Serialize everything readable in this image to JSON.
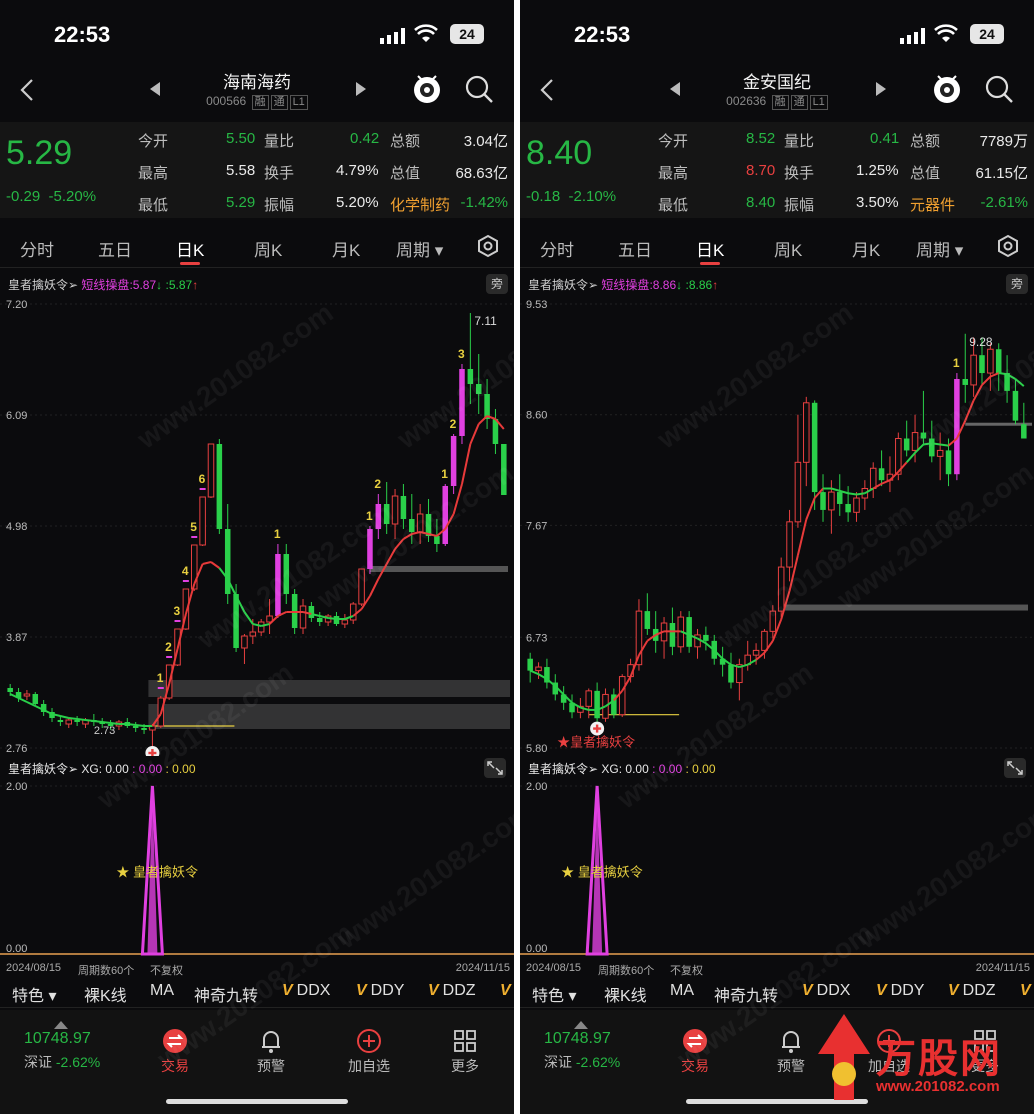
{
  "status_bar": {
    "time": "22:53",
    "battery": "24"
  },
  "bottom_tabs": {
    "index_value": "10748.97",
    "index_name": "深证",
    "index_change": "-2.62%",
    "trade": "交易",
    "alert": "预警",
    "add_watch": "加自选",
    "more": "更多"
  },
  "period_tabs": [
    "分时",
    "五日",
    "日K",
    "周K",
    "月K",
    "周期"
  ],
  "tools": {
    "special": "特色",
    "items": [
      "裸K线",
      "MA",
      "神奇九转"
    ],
    "v_items": [
      "DDX",
      "DDY",
      "DDZ"
    ]
  },
  "labels": {
    "open": "今开",
    "vol_ratio": "量比",
    "amount": "总额",
    "high": "最高",
    "turnover": "换手",
    "mktcap": "总值",
    "low": "最低",
    "amplitude": "振幅",
    "indicator_name": "皇者擒妖令",
    "pang": "旁",
    "signal_label": "★皇者擒妖令",
    "sub_signal_label": "★ 皇者擒妖令",
    "axis_start": "2024/08/15",
    "axis_period": "周期数60个",
    "axis_adj": "不复权",
    "axis_end": "2024/11/15"
  },
  "stocks": [
    {
      "name": "海南海药",
      "code": "000566",
      "tags": [
        "融",
        "通",
        "L1"
      ],
      "price": "5.29",
      "change": "-0.29",
      "change_pct": "-5.20%",
      "open": "5.50",
      "open_color": "g",
      "vol_ratio": "0.42",
      "amount": "3.04亿",
      "high": "5.58",
      "high_color": "w",
      "turnover": "4.79%",
      "mktcap": "68.63亿",
      "low": "5.29",
      "low_color": "g",
      "amplitude": "5.20%",
      "sector": "化学制药",
      "sector_pct": "-1.42%",
      "indicator": {
        "label": "短线操盘",
        "v1": "5.87",
        "v2": ":5.87"
      },
      "y_ticks": [
        "7.20",
        "6.09",
        "4.98",
        "3.87",
        "2.76"
      ],
      "ymin": 2.76,
      "ymax": 7.2,
      "peak_label": "7.11",
      "low_label": "2.73",
      "xg": {
        "label": "XG: 0.00",
        "v2": ": 0.00",
        "v3": ": 0.00"
      },
      "sub_y_ticks": [
        "2.00",
        "0.00"
      ],
      "signal_index": 17,
      "chart_data": {
        "type": "candlestick",
        "x": "trading days 2024/08/15 – 2024/11/15 (60)",
        "candles": [
          [
            3.36,
            3.4,
            3.28,
            3.32
          ],
          [
            3.32,
            3.36,
            3.22,
            3.26
          ],
          [
            3.28,
            3.34,
            3.24,
            3.3
          ],
          [
            3.3,
            3.32,
            3.18,
            3.2
          ],
          [
            3.2,
            3.24,
            3.08,
            3.12
          ],
          [
            3.12,
            3.16,
            3.02,
            3.06
          ],
          [
            3.04,
            3.08,
            2.98,
            3.02
          ],
          [
            3.0,
            3.06,
            2.96,
            3.04
          ],
          [
            3.04,
            3.08,
            2.98,
            3.02
          ],
          [
            3.0,
            3.06,
            2.96,
            3.04
          ],
          [
            3.04,
            3.1,
            2.98,
            3.02
          ],
          [
            3.02,
            3.06,
            2.96,
            3.0
          ],
          [
            3.0,
            3.04,
            2.94,
            2.98
          ],
          [
            2.98,
            3.04,
            2.94,
            3.02
          ],
          [
            3.02,
            3.06,
            2.96,
            2.98
          ],
          [
            2.98,
            3.02,
            2.92,
            2.96
          ],
          [
            2.96,
            3.0,
            2.9,
            2.94
          ],
          [
            2.94,
            3.0,
            2.73,
            2.98
          ],
          [
            2.98,
            3.28,
            2.96,
            3.26
          ],
          [
            3.26,
            3.59,
            3.24,
            3.59
          ],
          [
            3.59,
            3.95,
            3.58,
            3.95
          ],
          [
            3.95,
            4.35,
            3.94,
            4.35
          ],
          [
            4.35,
            4.79,
            4.33,
            4.79
          ],
          [
            4.79,
            5.27,
            4.78,
            5.27
          ],
          [
            5.27,
            5.8,
            5.26,
            5.8
          ],
          [
            5.8,
            5.85,
            4.9,
            4.95
          ],
          [
            4.95,
            5.2,
            4.2,
            4.3
          ],
          [
            4.3,
            4.4,
            3.72,
            3.76
          ],
          [
            3.76,
            3.9,
            3.6,
            3.88
          ],
          [
            3.88,
            4.05,
            3.8,
            3.92
          ],
          [
            3.92,
            4.05,
            3.88,
            4.02
          ],
          [
            4.02,
            4.25,
            3.9,
            4.08
          ],
          [
            4.08,
            4.8,
            4.06,
            4.7
          ],
          [
            4.7,
            4.8,
            4.2,
            4.3
          ],
          [
            4.3,
            4.35,
            3.9,
            3.96
          ],
          [
            3.96,
            4.25,
            3.9,
            4.18
          ],
          [
            4.18,
            4.22,
            4.02,
            4.06
          ],
          [
            4.06,
            4.12,
            3.98,
            4.02
          ],
          [
            4.02,
            4.1,
            3.98,
            4.08
          ],
          [
            4.08,
            4.12,
            3.98,
            4.0
          ],
          [
            4.0,
            4.1,
            3.96,
            4.04
          ],
          [
            4.04,
            4.22,
            4.0,
            4.2
          ],
          [
            4.2,
            4.55,
            4.18,
            4.55
          ],
          [
            4.55,
            4.98,
            4.5,
            4.95
          ],
          [
            4.95,
            5.3,
            4.85,
            5.2
          ],
          [
            5.2,
            5.42,
            4.9,
            5.0
          ],
          [
            5.0,
            5.35,
            4.85,
            5.28
          ],
          [
            5.28,
            5.4,
            4.95,
            5.05
          ],
          [
            5.05,
            5.3,
            4.8,
            4.92
          ],
          [
            4.92,
            5.2,
            4.8,
            5.1
          ],
          [
            5.1,
            5.25,
            4.82,
            4.88
          ],
          [
            4.88,
            5.05,
            4.72,
            4.8
          ],
          [
            4.8,
            5.4,
            4.78,
            5.38
          ],
          [
            5.38,
            5.9,
            5.3,
            5.88
          ],
          [
            5.88,
            6.6,
            5.8,
            6.55
          ],
          [
            6.55,
            7.11,
            6.2,
            6.4
          ],
          [
            6.4,
            6.7,
            6.1,
            6.3
          ],
          [
            6.3,
            6.45,
            5.95,
            6.05
          ],
          [
            6.05,
            6.15,
            5.7,
            5.8
          ],
          [
            5.8,
            5.58,
            5.29,
            5.29
          ]
        ],
        "ma_line": [
          3.3,
          3.26,
          3.22,
          3.18,
          3.14,
          3.1,
          3.08,
          3.06,
          3.05,
          3.04,
          3.03,
          3.02,
          3.01,
          3.0,
          3.0,
          2.99,
          2.98,
          2.98,
          3.1,
          3.4,
          3.75,
          4.1,
          4.4,
          4.6,
          4.62,
          4.56,
          4.45,
          4.28,
          4.12,
          4.0,
          3.98,
          4.0,
          4.08,
          4.12,
          4.12,
          4.12,
          4.1,
          4.08,
          4.06,
          4.05,
          4.05,
          4.08,
          4.15,
          4.28,
          4.45,
          4.6,
          4.75,
          4.85,
          4.9,
          4.92,
          4.9,
          4.88,
          4.95,
          5.1,
          5.4,
          5.8,
          6.0,
          6.08,
          6.05,
          5.95
        ],
        "ma_green_ranges": [
          [
            0,
            17
          ],
          [
            25,
            31
          ],
          [
            36,
            41
          ]
        ],
        "signal_numbers_up": [
          [
            18,
            "1"
          ],
          [
            19,
            "2"
          ],
          [
            20,
            "3"
          ],
          [
            21,
            "4"
          ],
          [
            22,
            "5"
          ],
          [
            23,
            "6"
          ]
        ],
        "signal_numbers_up2": [
          [
            32,
            "1"
          ],
          [
            43,
            "1"
          ],
          [
            44,
            "2"
          ],
          [
            52,
            "1"
          ],
          [
            53,
            "2"
          ],
          [
            54,
            "3"
          ]
        ],
        "support_bands": [
          [
            3.27,
            3.44
          ],
          [
            2.95,
            3.2
          ]
        ],
        "support_line": 4.55,
        "support_line_start": 43,
        "yellow_line": 2.98,
        "sub_spike_index": 17,
        "sub_ymax": 2.0
      }
    },
    {
      "name": "金安国纪",
      "code": "002636",
      "tags": [
        "融",
        "通",
        "L1"
      ],
      "price": "8.40",
      "change": "-0.18",
      "change_pct": "-2.10%",
      "open": "8.52",
      "open_color": "g",
      "vol_ratio": "0.41",
      "amount": "7789万",
      "high": "8.70",
      "high_color": "r",
      "turnover": "1.25%",
      "mktcap": "61.15亿",
      "low": "8.40",
      "low_color": "g",
      "amplitude": "3.50%",
      "sector": "元器件",
      "sector_pct": "-2.61%",
      "indicator": {
        "label": "短线操盘",
        "v1": "8.86",
        "v2": ":8.86"
      },
      "y_ticks": [
        "9.53",
        "8.60",
        "7.67",
        "6.73",
        "5.80"
      ],
      "ymin": 5.8,
      "ymax": 9.53,
      "peak_label": "9.28",
      "low_label": "",
      "xg": {
        "label": "XG: 0.00",
        "v2": ": 0.00",
        "v3": ": 0.00"
      },
      "sub_y_ticks": [
        "2.00",
        "0.00"
      ],
      "signal_index": 8,
      "chart_data": {
        "type": "candlestick",
        "x": "trading days 2024/08/15 – 2024/11/15 (60)",
        "candles": [
          [
            6.55,
            6.6,
            6.35,
            6.45
          ],
          [
            6.45,
            6.52,
            6.38,
            6.48
          ],
          [
            6.48,
            6.55,
            6.3,
            6.35
          ],
          [
            6.35,
            6.42,
            6.2,
            6.25
          ],
          [
            6.25,
            6.32,
            6.12,
            6.18
          ],
          [
            6.18,
            6.25,
            6.05,
            6.1
          ],
          [
            6.1,
            6.22,
            6.05,
            6.15
          ],
          [
            6.15,
            6.3,
            6.05,
            6.28
          ],
          [
            6.28,
            6.35,
            5.98,
            6.05
          ],
          [
            6.05,
            6.3,
            6.02,
            6.25
          ],
          [
            6.25,
            6.3,
            6.05,
            6.08
          ],
          [
            6.08,
            6.42,
            6.06,
            6.4
          ],
          [
            6.4,
            6.55,
            6.35,
            6.5
          ],
          [
            6.5,
            7.05,
            6.45,
            6.95
          ],
          [
            6.95,
            7.1,
            6.75,
            6.8
          ],
          [
            6.8,
            6.95,
            6.6,
            6.7
          ],
          [
            6.7,
            6.9,
            6.55,
            6.85
          ],
          [
            6.85,
            6.98,
            6.58,
            6.65
          ],
          [
            6.65,
            6.95,
            6.6,
            6.9
          ],
          [
            6.9,
            6.95,
            6.6,
            6.65
          ],
          [
            6.65,
            6.8,
            6.55,
            6.75
          ],
          [
            6.75,
            6.82,
            6.62,
            6.7
          ],
          [
            6.7,
            6.75,
            6.5,
            6.55
          ],
          [
            6.55,
            6.65,
            6.4,
            6.5
          ],
          [
            6.5,
            6.6,
            6.3,
            6.35
          ],
          [
            6.35,
            6.55,
            6.2,
            6.5
          ],
          [
            6.5,
            6.7,
            6.45,
            6.58
          ],
          [
            6.58,
            6.68,
            6.5,
            6.62
          ],
          [
            6.62,
            6.8,
            6.55,
            6.78
          ],
          [
            6.78,
            7.0,
            6.72,
            6.95
          ],
          [
            6.95,
            7.4,
            6.9,
            7.32
          ],
          [
            7.32,
            7.8,
            7.2,
            7.7
          ],
          [
            7.7,
            8.6,
            7.65,
            8.2
          ],
          [
            8.2,
            8.75,
            8.0,
            8.7
          ],
          [
            8.7,
            8.72,
            7.8,
            7.95
          ],
          [
            7.95,
            8.1,
            7.7,
            7.8
          ],
          [
            7.8,
            8.05,
            7.6,
            7.95
          ],
          [
            7.95,
            8.1,
            7.75,
            7.85
          ],
          [
            7.85,
            8.0,
            7.7,
            7.78
          ],
          [
            7.78,
            7.95,
            7.7,
            7.9
          ],
          [
            7.9,
            8.05,
            7.8,
            7.98
          ],
          [
            7.98,
            8.2,
            7.9,
            8.15
          ],
          [
            8.15,
            8.3,
            8.0,
            8.05
          ],
          [
            8.05,
            8.25,
            7.95,
            8.1
          ],
          [
            8.1,
            8.45,
            8.05,
            8.4
          ],
          [
            8.4,
            8.55,
            8.25,
            8.3
          ],
          [
            8.3,
            8.6,
            8.2,
            8.45
          ],
          [
            8.45,
            8.8,
            8.35,
            8.4
          ],
          [
            8.4,
            8.55,
            8.2,
            8.25
          ],
          [
            8.25,
            8.45,
            8.05,
            8.3
          ],
          [
            8.3,
            8.4,
            8.0,
            8.1
          ],
          [
            8.1,
            8.95,
            8.05,
            8.9
          ],
          [
            8.9,
            9.28,
            8.7,
            8.85
          ],
          [
            8.85,
            9.25,
            8.75,
            9.1
          ],
          [
            9.1,
            9.25,
            8.85,
            8.95
          ],
          [
            8.95,
            9.2,
            8.8,
            9.15
          ],
          [
            9.15,
            9.2,
            8.8,
            8.95
          ],
          [
            8.95,
            9.1,
            8.7,
            8.8
          ],
          [
            8.8,
            8.9,
            8.52,
            8.55
          ],
          [
            8.52,
            8.7,
            8.4,
            8.4
          ]
        ],
        "ma_line": [
          6.45,
          6.42,
          6.38,
          6.32,
          6.25,
          6.18,
          6.14,
          6.12,
          6.12,
          6.15,
          6.2,
          6.28,
          6.4,
          6.58,
          6.7,
          6.75,
          6.78,
          6.78,
          6.78,
          6.75,
          6.72,
          6.68,
          6.62,
          6.55,
          6.5,
          6.48,
          6.5,
          6.54,
          6.6,
          6.7,
          6.88,
          7.12,
          7.42,
          7.72,
          7.9,
          7.98,
          7.98,
          7.96,
          7.94,
          7.93,
          7.94,
          7.98,
          8.02,
          8.05,
          8.12,
          8.2,
          8.28,
          8.35,
          8.36,
          8.35,
          8.34,
          8.4,
          8.55,
          8.72,
          8.85,
          8.92,
          8.95,
          8.94,
          8.9,
          8.84
        ],
        "ma_green_ranges": [
          [
            0,
            10
          ],
          [
            18,
            27
          ],
          [
            35,
            41
          ],
          [
            45,
            50
          ],
          [
            56,
            59
          ]
        ],
        "signal_numbers_up": [],
        "signal_numbers_up2": [
          [
            51,
            "1"
          ]
        ],
        "support_bands": [],
        "support_line": 6.98,
        "support_line_start": 30,
        "support_line2": 8.52,
        "support_line2_start": 52,
        "yellow_line": 6.08,
        "sub_spike_index": 8,
        "sub_ymax": 2.0
      }
    }
  ],
  "brand_overlay": {
    "title": "万股网",
    "url": "www.201082.com"
  },
  "watermark": "www.201082.com"
}
